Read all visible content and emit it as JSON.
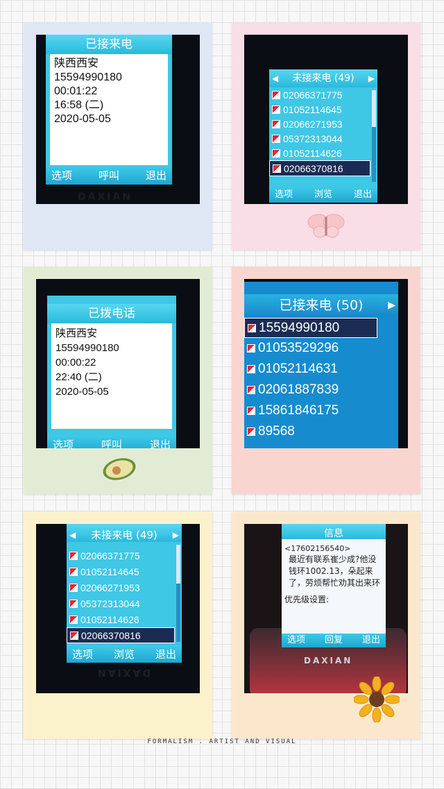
{
  "cards": {
    "c1": {
      "title": "已接来电",
      "lines": [
        "陕西西安",
        "15594990180",
        "00:01:22",
        "16:58 (二)",
        "2020-05-05"
      ],
      "soft": [
        "选项",
        "呼叫",
        "退出"
      ],
      "brand": "DAXIAN"
    },
    "c2": {
      "title": "未接来电 (49)",
      "rows": [
        "02066371775",
        "01052114645",
        "02066271953",
        "05372313044",
        "01052114626",
        "02066370816"
      ],
      "soft": [
        "选项",
        "浏览",
        "退出"
      ]
    },
    "c3": {
      "title": "已拨电话",
      "lines": [
        "陕西西安",
        "15594990180",
        "00:00:22",
        "22:40 (二)",
        "2020-05-05"
      ],
      "soft": [
        "选项",
        "呼叫",
        "退出"
      ]
    },
    "c4": {
      "title": "已接来电 (50)",
      "rows": [
        "15594990180",
        "01053529296",
        "01052114631",
        "02061887839",
        "15861846175",
        "89568"
      ]
    },
    "c5": {
      "title": "未接来电 (49)",
      "rows": [
        "02066371775",
        "01052114645",
        "02066271953",
        "05372313044",
        "01052114626",
        "02066370816"
      ],
      "soft": [
        "选项",
        "浏览",
        "退出"
      ],
      "brand": "DAXIAN"
    },
    "c6": {
      "title": "信息",
      "sender": "<17602156540>",
      "message": "最近有联系崔少成?他没钱环1002.13，朵起来了，劳烦帮忙劝其出来环",
      "priority": "优先级设置:",
      "soft": [
        "选项",
        "回复",
        "退出"
      ],
      "brand": "DAXIAN"
    }
  },
  "colors": {
    "card1": "#dfe7f5",
    "card2": "#f9dde7",
    "card3": "#e2ecd5",
    "card4": "#f8d6cf",
    "card5": "#fbf2cc",
    "card6": "#fbe8cc",
    "screen": "#3fc7e6"
  },
  "footer": "FORMALISM  .  ARTIST AND VISUAL"
}
